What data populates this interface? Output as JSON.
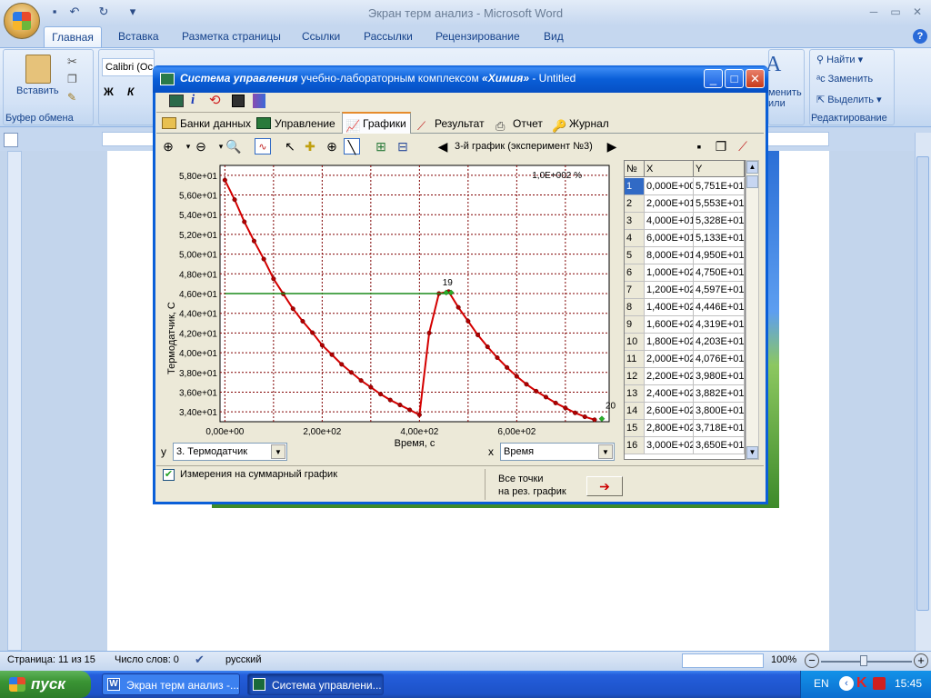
{
  "word": {
    "title": "Экран терм анализ - Microsoft Word",
    "tabs": [
      "Главная",
      "Вставка",
      "Разметка страницы",
      "Ссылки",
      "Рассылки",
      "Рецензирование",
      "Вид"
    ],
    "paste_label": "Вставить",
    "clipboard_group": "Буфер обмена",
    "font_name": "Calibri (Ос",
    "find_label": "Найти",
    "replace_label": "Заменить",
    "select_label": "Выделить",
    "edit_group": "Редактирование",
    "styles_partial": "менить\nили",
    "status": {
      "page": "Страница: 11 из 15",
      "words": "Число слов: 0",
      "lang": "русский",
      "zoom": "100%"
    }
  },
  "taskbar": {
    "start": "пуск",
    "task1": "Экран терм анализ -...",
    "task2": "Система управлени...",
    "lang": "EN",
    "time": "15:45"
  },
  "app": {
    "title_italic": "Система управления",
    "title_rest": " учебно-лабораторным комплексом ",
    "title_brand": "«Химия»",
    "title_tail": " - Untitled",
    "tabs": [
      "Банки данных",
      "Управление",
      "Графики",
      "Результат",
      "Отчет",
      "Журнал"
    ],
    "nav_label": "3-й график (эксперимент №3)",
    "y_combo_label": "y",
    "y_combo_value": "3. Термодатчик",
    "x_combo_label": "x",
    "x_combo_value": "Время",
    "checkbox_label": "Измерения на суммарный график",
    "all_points_line1": "Все точки",
    "all_points_line2": "на рез. график"
  },
  "chart_data": {
    "type": "line",
    "annotation": "1,0E+002 %",
    "xlabel": "Время, с",
    "ylabel": "Термодатчик, С",
    "xlim": [
      -10,
      790
    ],
    "ylim": [
      33,
      59
    ],
    "x_ticks": [
      "0,00e+00",
      "2,00e+02",
      "4,00e+02",
      "6,00e+02"
    ],
    "x_tick_values": [
      0,
      200,
      400,
      600
    ],
    "y_ticks": [
      "5,80e+01",
      "5,60e+01",
      "5,40e+01",
      "5,20e+01",
      "5,00e+01",
      "4,80e+01",
      "4,60e+01",
      "4,40e+01",
      "4,20e+01",
      "4,00e+01",
      "3,80e+01",
      "3,60e+01",
      "3,40e+01"
    ],
    "y_tick_values": [
      58,
      56,
      54,
      52,
      50,
      48,
      46,
      44,
      42,
      40,
      38,
      36,
      34
    ],
    "point_labels": [
      {
        "text": "19",
        "x": 440,
        "y": 46.1
      },
      {
        "text": "20",
        "x": 775,
        "y": 33.6
      }
    ],
    "series": [
      {
        "color": "#d40000",
        "x": [
          0,
          20,
          40,
          60,
          80,
          100,
          120,
          140,
          160,
          180,
          200,
          220,
          240,
          260,
          280,
          300,
          320,
          340,
          360,
          380,
          400,
          420,
          440,
          460,
          480,
          500,
          520,
          540,
          560,
          580,
          600,
          620,
          640,
          660,
          680,
          700,
          720,
          740,
          760
        ],
        "y": [
          57.51,
          55.53,
          53.28,
          51.33,
          49.5,
          47.5,
          45.97,
          44.46,
          43.19,
          42.03,
          40.76,
          39.8,
          38.82,
          38.0,
          37.18,
          36.5,
          35.8,
          35.2,
          34.7,
          34.2,
          33.7,
          42.0,
          46.0,
          46.2,
          44.6,
          43.2,
          41.8,
          40.6,
          39.5,
          38.5,
          37.6,
          36.8,
          36.1,
          35.5,
          34.9,
          34.4,
          33.9,
          33.5,
          33.2
        ]
      },
      {
        "color": "#1a8a1a",
        "x": [
          0,
          460
        ],
        "y": [
          46,
          46
        ]
      }
    ]
  },
  "table": {
    "headers": [
      "№",
      "X",
      "Y"
    ],
    "rows": [
      [
        "1",
        "0,000E+00",
        "5,751E+01"
      ],
      [
        "2",
        "2,000E+01",
        "5,553E+01"
      ],
      [
        "3",
        "4,000E+01",
        "5,328E+01"
      ],
      [
        "4",
        "6,000E+01",
        "5,133E+01"
      ],
      [
        "5",
        "8,000E+01",
        "4,950E+01"
      ],
      [
        "6",
        "1,000E+02",
        "4,750E+01"
      ],
      [
        "7",
        "1,200E+02",
        "4,597E+01"
      ],
      [
        "8",
        "1,400E+02",
        "4,446E+01"
      ],
      [
        "9",
        "1,600E+02",
        "4,319E+01"
      ],
      [
        "10",
        "1,800E+02",
        "4,203E+01"
      ],
      [
        "11",
        "2,000E+02",
        "4,076E+01"
      ],
      [
        "12",
        "2,200E+02",
        "3,980E+01"
      ],
      [
        "13",
        "2,400E+02",
        "3,882E+01"
      ],
      [
        "14",
        "2,600E+02",
        "3,800E+01"
      ],
      [
        "15",
        "2,800E+02",
        "3,718E+01"
      ],
      [
        "16",
        "3,000E+02",
        "3,650E+01"
      ]
    ]
  }
}
